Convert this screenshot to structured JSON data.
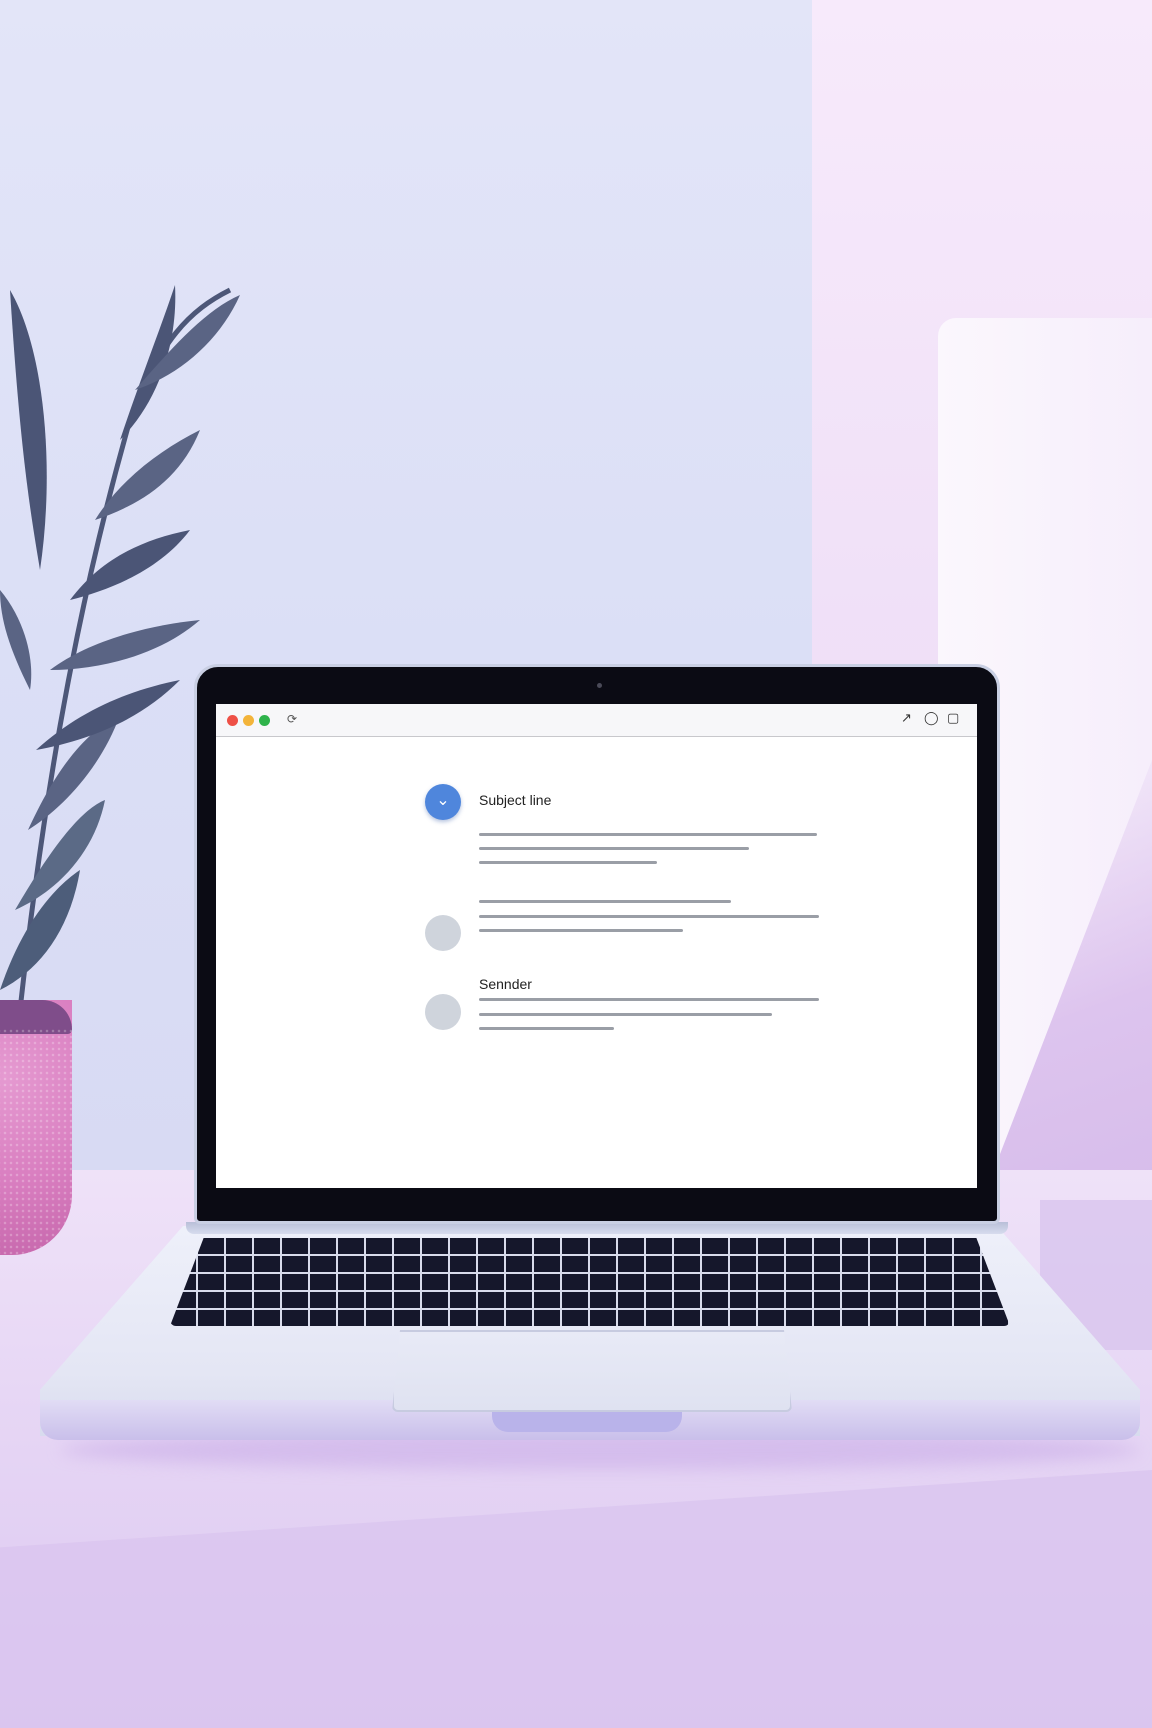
{
  "browser": {
    "reload_icon": "reload-icon",
    "window_controls": [
      "↗",
      "◯",
      "▢"
    ]
  },
  "email_list": {
    "items": [
      {
        "label": "Subject line",
        "avatar": "check-icon"
      },
      {
        "label": "",
        "avatar": "avatar"
      },
      {
        "label": "Sennder",
        "avatar": "avatar"
      }
    ]
  },
  "colors": {
    "accent": "#4f86dc",
    "close": "#ee5046",
    "minimize": "#f3b43a",
    "maximize": "#2fb34b"
  }
}
